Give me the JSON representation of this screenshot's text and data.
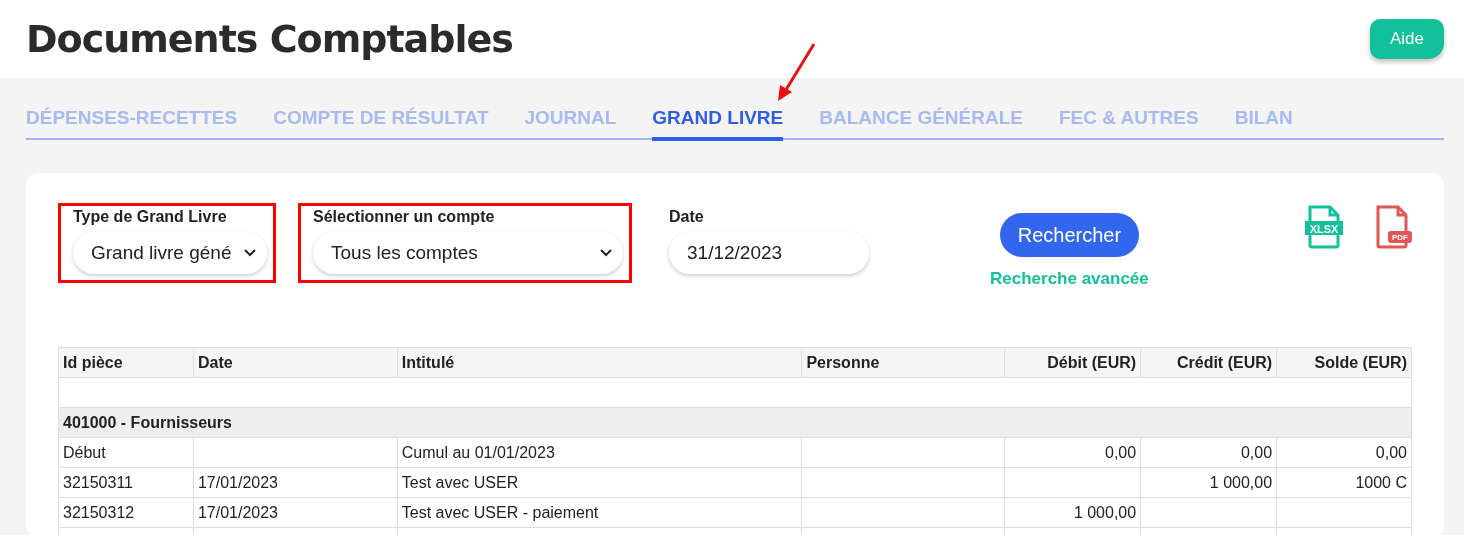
{
  "page": {
    "title": "Documents Comptables",
    "help_button": "Aide"
  },
  "tabs": [
    {
      "label": "DÉPENSES-RECETTES",
      "selected": false,
      "pointed": false
    },
    {
      "label": "COMPTE DE RÉSULTAT",
      "selected": false,
      "pointed": false
    },
    {
      "label": "JOURNAL",
      "selected": false,
      "pointed": false
    },
    {
      "label": "GRAND LIVRE",
      "selected": true,
      "pointed": true
    },
    {
      "label": "BALANCE GÉNÉRALE",
      "selected": false,
      "pointed": false
    },
    {
      "label": "FEC & AUTRES",
      "selected": false,
      "pointed": false
    },
    {
      "label": "BILAN",
      "selected": false,
      "pointed": false
    }
  ],
  "filters": [
    {
      "kind": "select",
      "label": "Type de Grand Livre",
      "value": "Grand livre géné",
      "highlighted": true
    },
    {
      "kind": "select",
      "label": "Sélectionner un compte",
      "value": "Tous les comptes",
      "highlighted": true
    },
    {
      "kind": "date",
      "label": "Date",
      "value": "31/12/2023",
      "highlighted": false
    }
  ],
  "search_button": "Rechercher",
  "advanced_search": "Recherche avancée",
  "exports": [
    {
      "kind": "xlsx",
      "label": "XLSX"
    },
    {
      "kind": "pdf",
      "label": "PDF"
    }
  ],
  "table": {
    "columns": [
      "Id pièce",
      "Date",
      "Intitulé",
      "Personne",
      "Débit (EUR)",
      "Crédit (EUR)",
      "Solde (EUR)"
    ],
    "rows": [
      {
        "kind": "blank"
      },
      {
        "kind": "group",
        "label": "401000 - Fournisseurs"
      },
      {
        "kind": "entry",
        "cells": [
          "Début",
          "",
          "Cumul au 01/01/2023",
          "",
          "0,00",
          "0,00",
          "0,00"
        ]
      },
      {
        "kind": "entry",
        "cells": [
          "32150311",
          "17/01/2023",
          "Test avec USER",
          "",
          "",
          "1 000,00",
          "1000 C"
        ]
      },
      {
        "kind": "entry",
        "cells": [
          "32150312",
          "17/01/2023",
          "Test avec USER - paiement",
          "",
          "1 000,00",
          "",
          ""
        ]
      },
      {
        "kind": "entry",
        "cells": [
          "",
          "",
          "",
          "",
          "",
          "",
          ""
        ]
      }
    ]
  }
}
